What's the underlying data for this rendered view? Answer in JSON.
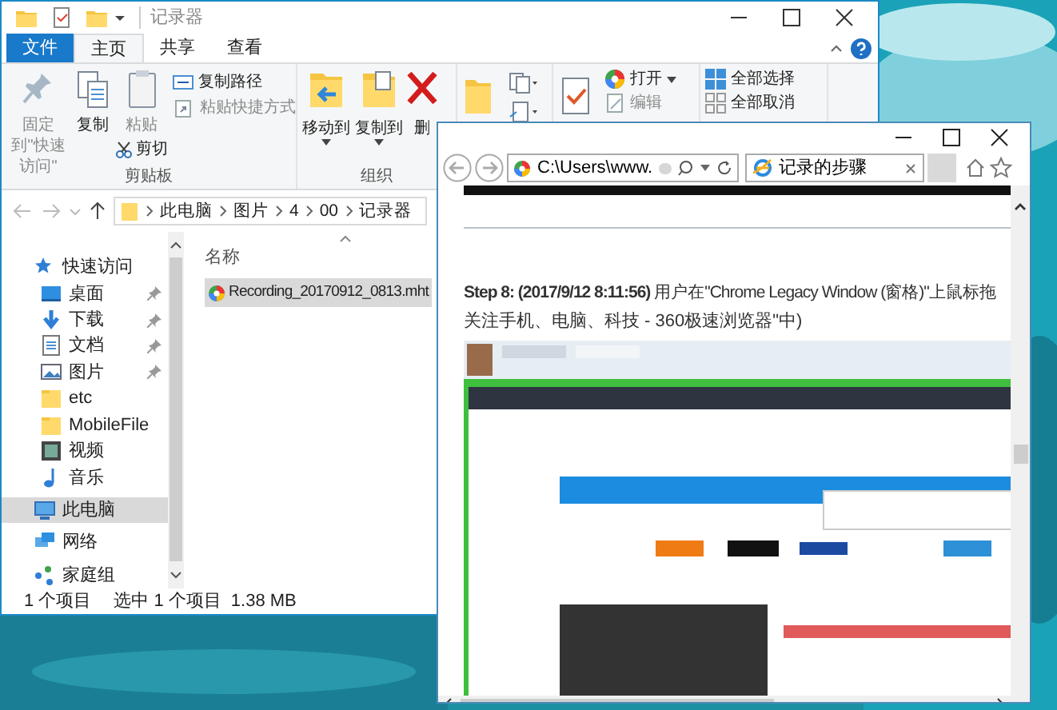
{
  "explorer": {
    "title": "记录器",
    "ribbon_tabs": [
      {
        "label": "文件",
        "kind": "file",
        "selected": false
      },
      {
        "label": "主页",
        "kind": "tab",
        "selected": true
      },
      {
        "label": "共享",
        "kind": "tab",
        "selected": false
      },
      {
        "label": "查看",
        "kind": "tab",
        "selected": false
      }
    ],
    "clipboard": {
      "pin": {
        "label": "固定到\"快速访问\"",
        "disabled": true
      },
      "copy": {
        "label": "复制",
        "disabled": false
      },
      "paste": {
        "label": "粘贴",
        "disabled": true
      },
      "copy_path": {
        "label": "复制路径",
        "disabled": false
      },
      "paste_shortcut": {
        "label": "粘贴快捷方式",
        "disabled": true
      },
      "cut": {
        "label": "剪切",
        "disabled": false
      },
      "group_label": "剪贴板"
    },
    "organize": {
      "move_to": "移动到",
      "copy_to": "复制到",
      "delete": "删",
      "group_label": "组织"
    },
    "open": {
      "open": {
        "label": "打开",
        "disabled": false
      },
      "edit": {
        "label": "编辑",
        "disabled": true
      }
    },
    "select": {
      "select_all": "全部选择",
      "select_none": "全部取消"
    },
    "address": {
      "path": [
        "此电脑",
        "图片",
        "4",
        "00",
        "记录器"
      ]
    },
    "nav_pane": [
      {
        "label": "快速访问",
        "selected": false,
        "children": [
          {
            "label": "桌面",
            "selected": false,
            "pinned": true
          },
          {
            "label": "下载",
            "selected": false,
            "pinned": true
          },
          {
            "label": "文档",
            "selected": false,
            "pinned": true
          },
          {
            "label": "图片",
            "selected": false,
            "pinned": true
          },
          {
            "label": "etc",
            "selected": false,
            "pinned": false
          },
          {
            "label": "MobileFile",
            "selected": false,
            "pinned": false
          },
          {
            "label": "视频",
            "selected": false,
            "pinned": false
          },
          {
            "label": "音乐",
            "selected": false,
            "pinned": false
          }
        ]
      },
      {
        "label": "此电脑",
        "selected": true
      },
      {
        "label": "网络",
        "selected": false
      },
      {
        "label": "家庭组",
        "selected": false
      }
    ],
    "content": {
      "column_header": "名称",
      "files": [
        {
          "name": "Recording_20170912_0813.mht",
          "selected": true
        }
      ]
    },
    "status_bar": {
      "item_count": "1 个项目",
      "selection": "选中 1 个项目",
      "size": "1.38 MB"
    }
  },
  "browser": {
    "address": "C:\\Users\\www.",
    "tab": {
      "title": "记录的步骤"
    },
    "step": {
      "line_1": "**Step 8: (2017/9/12 8:11:56)** 用户在\"Chrome Legacy Window (窗格)\"上鼠标拖",
      "line_2": "关注手机、电脑、科技 - 360极速浏览器\"中)"
    }
  }
}
